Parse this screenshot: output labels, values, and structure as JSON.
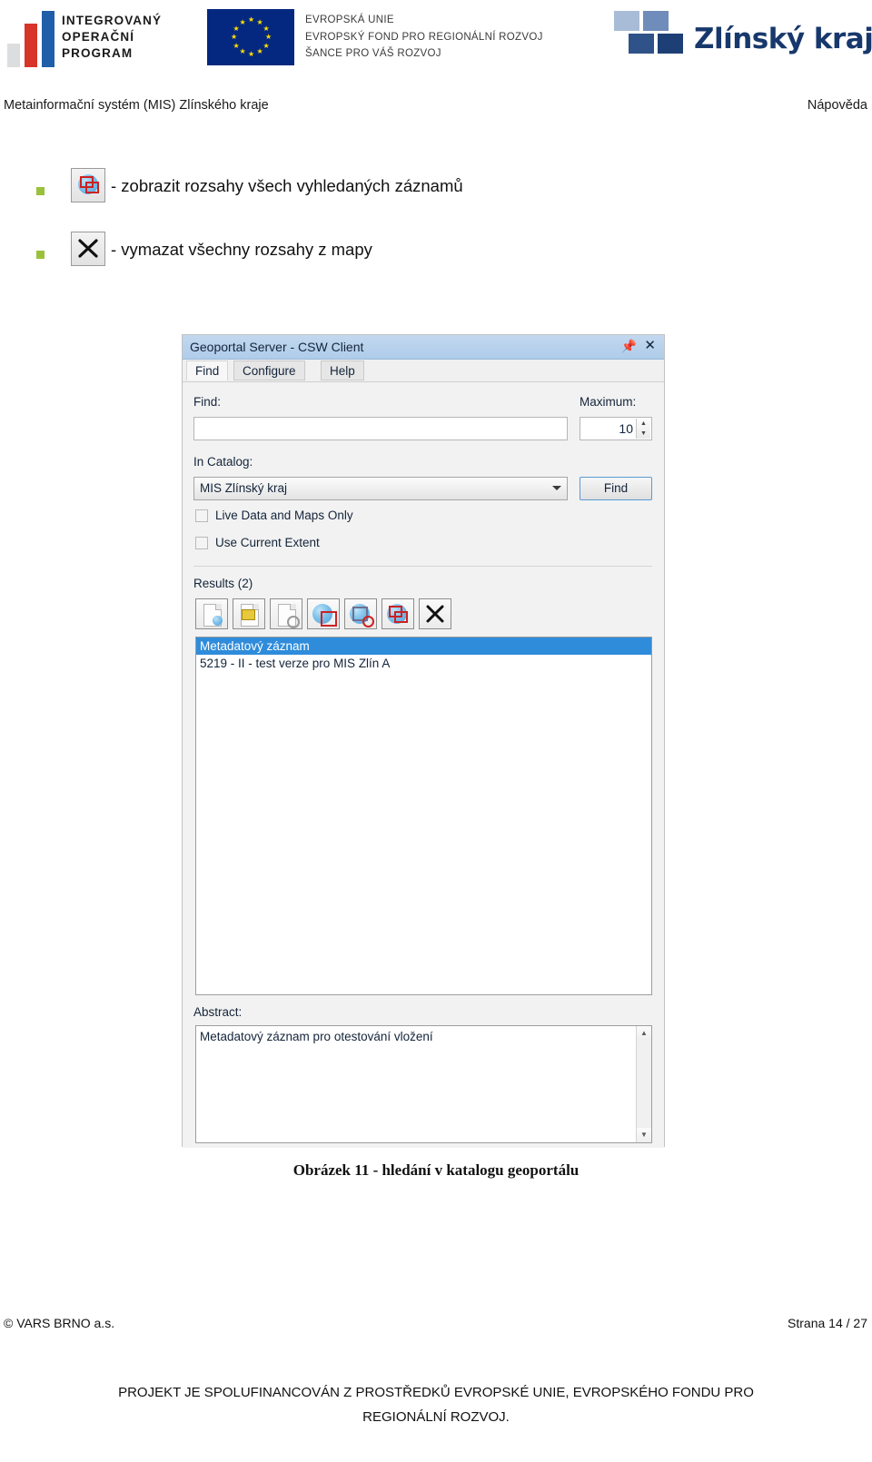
{
  "header": {
    "iop_logo": {
      "name": "integrovany-operacni-program-logo",
      "lines": "INTEGROVANÝ\nOPERAČNÍ\nPROGRAM",
      "line1": "INTEGROVANÝ",
      "line2": "OPERAČNÍ",
      "line3": "PROGRAM",
      "bar_colors": [
        "#dcdddf",
        "#d7342a",
        "#1f5fa9"
      ]
    },
    "eu_logo": {
      "name": "european-union-flag",
      "flag_color": "#04287f",
      "star_color": "#ffe000",
      "line1": "EVROPSKÁ UNIE",
      "line2": "EVROPSKÝ FOND PRO REGIONÁLNÍ ROZVOJ",
      "line3": "ŠANCE PRO VÁŠ ROZVOJ"
    },
    "zlinsky_logo": {
      "name": "zlinsky-kraj-logo",
      "text": "Zlínský kraj",
      "square_colors": [
        "#a8bcd8",
        "#6f8cba",
        "#2f5289",
        "#1d3f75"
      ],
      "text_color": "#17386c"
    }
  },
  "running_head": {
    "left": "Metainformační systém (MIS) Zlínského kraje",
    "right": "Nápověda"
  },
  "bullets": [
    {
      "icon": "show-extents-of-all-found-records-icon",
      "text": "- zobrazit rozsahy všech vyhledaných záznamů",
      "marker_color": "#9ac13c"
    },
    {
      "icon": "clear-all-extents-icon",
      "text": "- vymazat všechny rozsahy z mapy",
      "marker_color": "#9ac13c"
    }
  ],
  "panel": {
    "title": "Geoportal Server - CSW Client",
    "pin_icon": "pin-icon",
    "close_icon": "close-icon",
    "tabs": [
      {
        "label": "Find",
        "active": true
      },
      {
        "label": "Configure",
        "active": false
      },
      {
        "label": "Help",
        "active": false
      }
    ],
    "find_label": "Find:",
    "find_value": "",
    "maximum_label": "Maximum:",
    "maximum_value": "10",
    "in_catalog_label": "In Catalog:",
    "catalog_selected": "MIS Zlínský kraj",
    "find_button": "Find",
    "checkboxes": [
      {
        "label": "Live Data and Maps Only",
        "checked": false
      },
      {
        "label": "Use Current Extent",
        "checked": false
      }
    ],
    "results_label": "Results (2)",
    "toolbar": [
      "view-metadata-details-icon",
      "view-metadata-summary-icon",
      "preview-document-icon",
      "add-to-map-icon",
      "zoom-to-extent-icon",
      "show-all-extents-icon",
      "clear-extents-icon"
    ],
    "results": [
      {
        "text": "Metadatový záznam",
        "selected": true
      },
      {
        "text": "5219 - II - test verze pro MIS Zlín A",
        "selected": false
      }
    ],
    "abstract_label": "Abstract:",
    "abstract_text": "Metadatový záznam pro otestování vložení",
    "highlight_color": "#2f8cdb"
  },
  "caption": "Obrázek 11 - hledání v katalogu geoportálu",
  "footer": {
    "left": "© VARS BRNO a.s.",
    "right": "Strana 14 / 27",
    "project_line1": "PROJEKT JE SPOLUFINANCOVÁN Z PROSTŘEDKŮ EVROPSKÉ UNIE, EVROPSKÉHO FONDU PRO",
    "project_line2": "REGIONÁLNÍ ROZVOJ."
  }
}
